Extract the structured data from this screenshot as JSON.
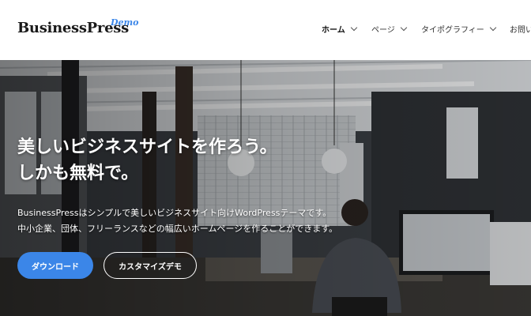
{
  "header": {
    "logo_text": "BusinessPress",
    "logo_badge": "Demo",
    "nav": [
      {
        "label": "ホーム",
        "active": true
      },
      {
        "label": "ページ",
        "active": false
      },
      {
        "label": "タイポグラフィー",
        "active": false
      },
      {
        "label": "お問い合わせ",
        "active": false
      }
    ]
  },
  "hero": {
    "title_line1": "美しいビジネスサイトを作ろう。",
    "title_line2": "しかも無料で。",
    "desc_line1": "BusinessPressはシンプルで美しいビジネスサイト向けWordPressテーマです。",
    "desc_line2": "中小企業、団体、フリーランスなどの幅広いホームページを作ることができます。",
    "primary_button": "ダウンロード",
    "secondary_button": "カスタマイズデモ"
  },
  "colors": {
    "accent": "#3b86e8",
    "header_bg": "#ffffff",
    "text_dark": "#1a1a1a"
  }
}
